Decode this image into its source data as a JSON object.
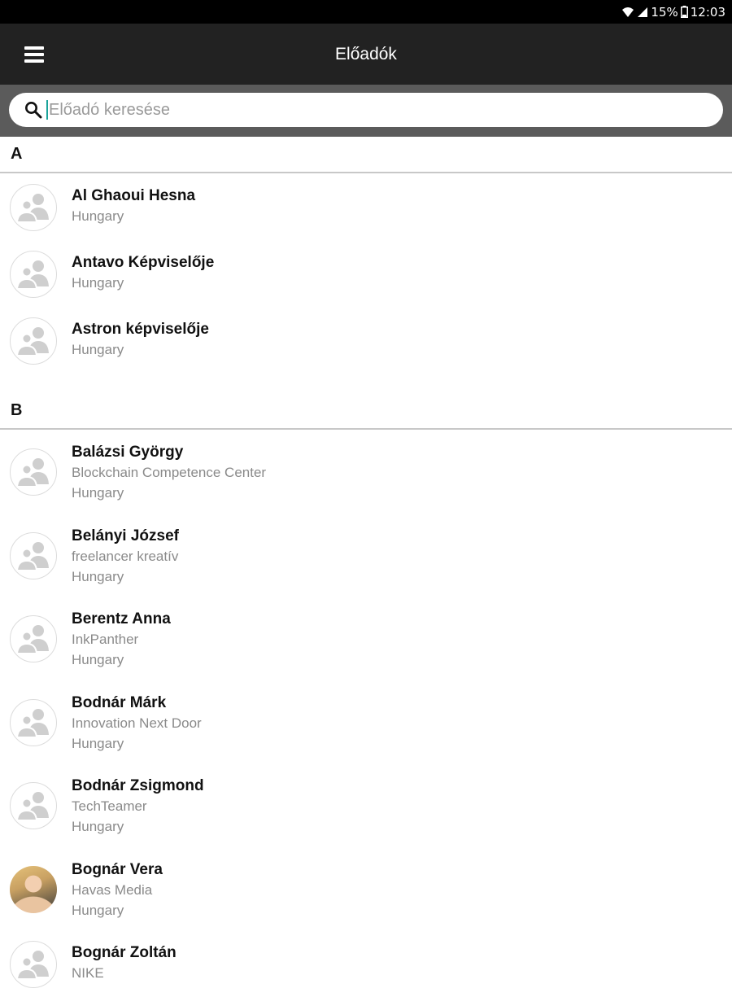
{
  "status_bar": {
    "battery": "15%",
    "time": "12:03",
    "icons": [
      "wifi-icon",
      "signal-icon",
      "battery-icon"
    ]
  },
  "app_bar": {
    "title": "Előadók",
    "menu_icon": "hamburger-menu-icon"
  },
  "search": {
    "placeholder": "Előadó keresése",
    "value": "",
    "icon": "search-icon"
  },
  "colors": {
    "status_bar_bg": "#000000",
    "app_bar_bg": "#222222",
    "search_bar_bg": "#5b5b5b",
    "caret": "#1aa39a"
  },
  "sections": [
    {
      "letter": "A",
      "items": [
        {
          "name": "Al Ghaoui Hesna",
          "org": "",
          "country": "Hungary",
          "avatar": "placeholder"
        },
        {
          "name": "Antavo Képviselője",
          "org": "",
          "country": "Hungary",
          "avatar": "placeholder"
        },
        {
          "name": "Astron képviselője",
          "org": "",
          "country": "Hungary",
          "avatar": "placeholder"
        }
      ]
    },
    {
      "letter": "B",
      "items": [
        {
          "name": "Balázsi György",
          "org": "Blockchain Competence Center",
          "country": "Hungary",
          "avatar": "placeholder"
        },
        {
          "name": "Belányi József",
          "org": "freelancer kreatív",
          "country": "Hungary",
          "avatar": "placeholder"
        },
        {
          "name": "Berentz Anna",
          "org": "InkPanther",
          "country": "Hungary",
          "avatar": "placeholder"
        },
        {
          "name": "Bodnár Márk",
          "org": "Innovation Next Door",
          "country": "Hungary",
          "avatar": "placeholder"
        },
        {
          "name": "Bodnár Zsigmond",
          "org": "TechTeamer",
          "country": "Hungary",
          "avatar": "placeholder"
        },
        {
          "name": "Bognár Vera",
          "org": "Havas Media",
          "country": "Hungary",
          "avatar": "photo"
        },
        {
          "name": "Bognár Zoltán",
          "org": "NIKE",
          "country": "",
          "avatar": "placeholder"
        }
      ]
    }
  ]
}
